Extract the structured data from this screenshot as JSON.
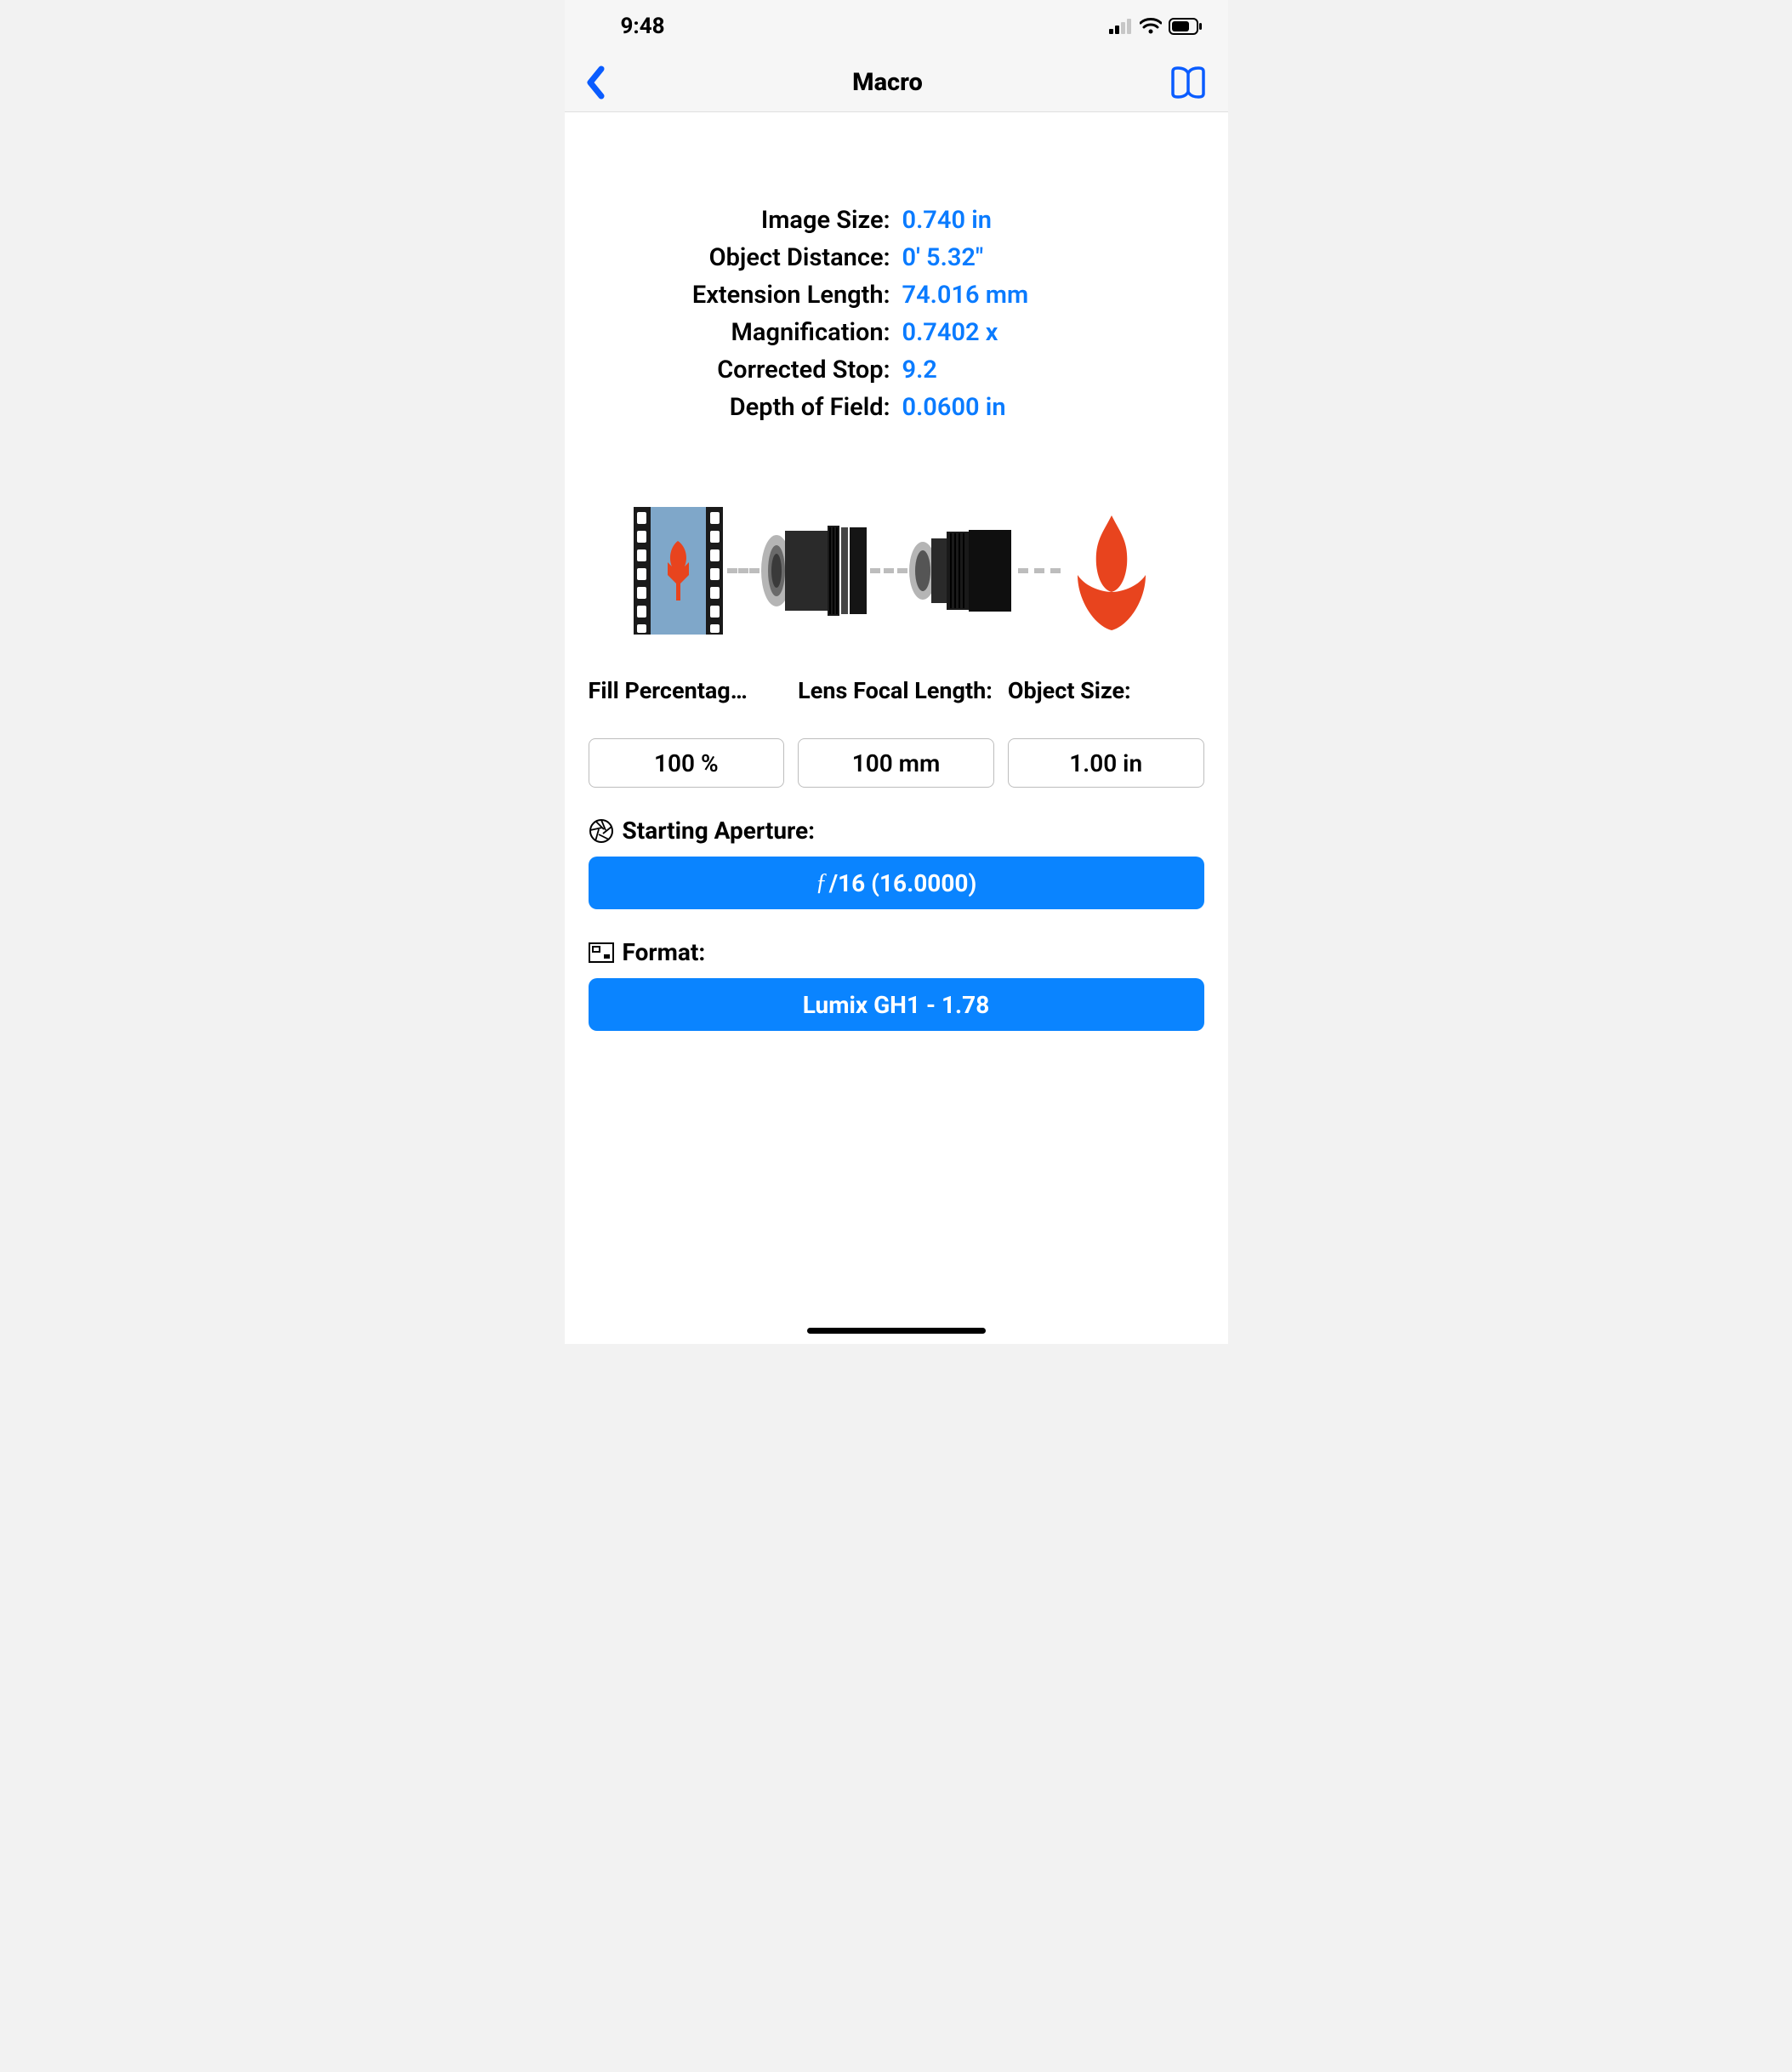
{
  "statusbar": {
    "time": "9:48"
  },
  "navbar": {
    "title": "Macro"
  },
  "results": {
    "image_size_label": "Image Size:",
    "image_size_value": "0.740 in",
    "object_distance_label": "Object Distance:",
    "object_distance_value": "0' 5.32\"",
    "extension_length_label": "Extension Length:",
    "extension_length_value": "74.016 mm",
    "magnification_label": "Magnification:",
    "magnification_value": "0.7402 x",
    "corrected_stop_label": "Corrected Stop:",
    "corrected_stop_value": "9.2",
    "depth_of_field_label": "Depth of Field:",
    "depth_of_field_value": "0.0600 in"
  },
  "inputs": {
    "fill_percentage_label": "Fill Percentag…",
    "fill_percentage_value": "100 %",
    "lens_focal_length_label": "Lens Focal Length:",
    "lens_focal_length_value": "100 mm",
    "object_size_label": "Object Size:",
    "object_size_value": "1.00 in"
  },
  "aperture": {
    "label": "Starting Aperture:",
    "f_prefix": "ƒ",
    "value": "/16 (16.0000)"
  },
  "format": {
    "label": "Format:",
    "value": "Lumix GH1 - 1.78"
  }
}
